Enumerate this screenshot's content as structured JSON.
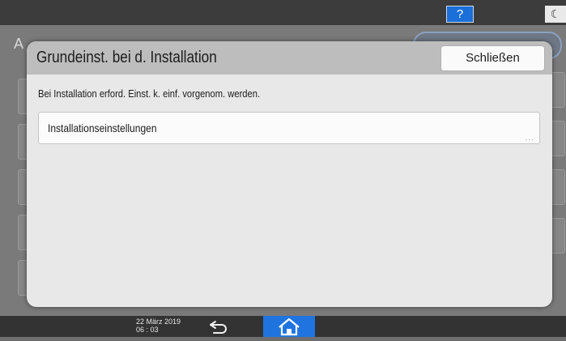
{
  "topbar": {
    "help_label": "?",
    "night_icon": "moon-icon"
  },
  "background": {
    "title": "A"
  },
  "dialog": {
    "title": "Grundeinst. bei d. Installation",
    "close_label": "Schließen",
    "description": "Bei Installation erford. Einst. k. einf. vorgenom. werden.",
    "items": [
      {
        "label": "Installationseinstellungen",
        "more": "..."
      }
    ]
  },
  "bottombar": {
    "date": "22 März 2019",
    "time": "06 : 03",
    "back_icon": "back-arrow-icon",
    "home_icon": "home-icon"
  },
  "colors": {
    "help_button": "#1a6fd8",
    "home_button": "#1f74e0",
    "dialog_header": "#bdbdbd",
    "dialog_body": "#e8e8e8"
  }
}
